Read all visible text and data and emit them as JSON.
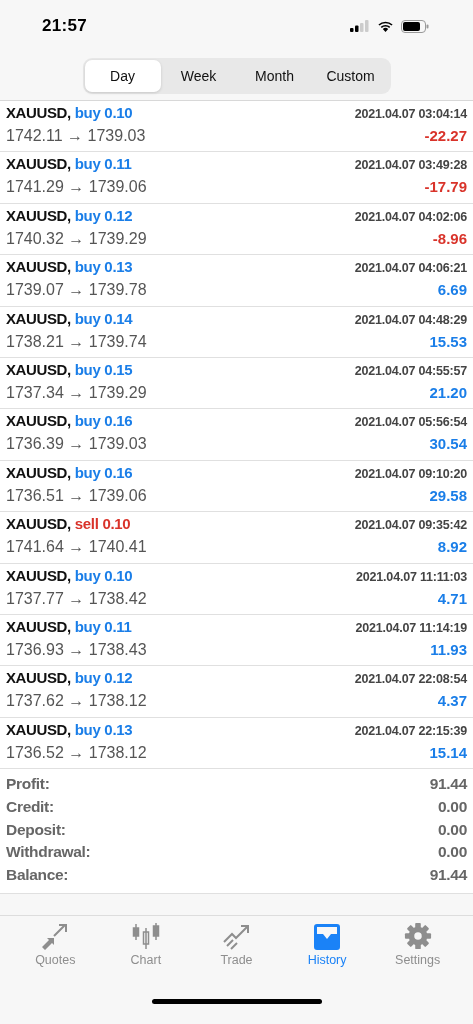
{
  "status_bar": {
    "time": "21:57"
  },
  "period_tabs": [
    {
      "label": "Day",
      "selected": true
    },
    {
      "label": "Week",
      "selected": false
    },
    {
      "label": "Month",
      "selected": false
    },
    {
      "label": "Custom",
      "selected": false
    }
  ],
  "deals": [
    {
      "symbol": "XAUUSD,",
      "kind": "buy",
      "order": "buy 0.10",
      "time": "2021.04.07 03:04:14",
      "prices": "1742.11 → 1739.03",
      "profit": "-22.27",
      "loss": true
    },
    {
      "symbol": "XAUUSD,",
      "kind": "buy",
      "order": "buy 0.11",
      "time": "2021.04.07 03:49:28",
      "prices": "1741.29 → 1739.06",
      "profit": "-17.79",
      "loss": true
    },
    {
      "symbol": "XAUUSD,",
      "kind": "buy",
      "order": "buy 0.12",
      "time": "2021.04.07 04:02:06",
      "prices": "1740.32 → 1739.29",
      "profit": "-8.96",
      "loss": true
    },
    {
      "symbol": "XAUUSD,",
      "kind": "buy",
      "order": "buy 0.13",
      "time": "2021.04.07 04:06:21",
      "prices": "1739.07 → 1739.78",
      "profit": "6.69",
      "loss": false
    },
    {
      "symbol": "XAUUSD,",
      "kind": "buy",
      "order": "buy 0.14",
      "time": "2021.04.07 04:48:29",
      "prices": "1738.21 → 1739.74",
      "profit": "15.53",
      "loss": false
    },
    {
      "symbol": "XAUUSD,",
      "kind": "buy",
      "order": "buy 0.15",
      "time": "2021.04.07 04:55:57",
      "prices": "1737.34 → 1739.29",
      "profit": "21.20",
      "loss": false
    },
    {
      "symbol": "XAUUSD,",
      "kind": "buy",
      "order": "buy 0.16",
      "time": "2021.04.07 05:56:54",
      "prices": "1736.39 → 1739.03",
      "profit": "30.54",
      "loss": false
    },
    {
      "symbol": "XAUUSD,",
      "kind": "buy",
      "order": "buy 0.16",
      "time": "2021.04.07 09:10:20",
      "prices": "1736.51 → 1739.06",
      "profit": "29.58",
      "loss": false
    },
    {
      "symbol": "XAUUSD,",
      "kind": "sell",
      "order": "sell 0.10",
      "time": "2021.04.07 09:35:42",
      "prices": "1741.64 → 1740.41",
      "profit": "8.92",
      "loss": false
    },
    {
      "symbol": "XAUUSD,",
      "kind": "buy",
      "order": "buy 0.10",
      "time": "2021.04.07 11:11:03",
      "prices": "1737.77 → 1738.42",
      "profit": "4.71",
      "loss": false
    },
    {
      "symbol": "XAUUSD,",
      "kind": "buy",
      "order": "buy 0.11",
      "time": "2021.04.07 11:14:19",
      "prices": "1736.93 → 1738.43",
      "profit": "11.93",
      "loss": false
    },
    {
      "symbol": "XAUUSD,",
      "kind": "buy",
      "order": "buy 0.12",
      "time": "2021.04.07 22:08:54",
      "prices": "1737.62 → 1738.12",
      "profit": "4.37",
      "loss": false
    },
    {
      "symbol": "XAUUSD,",
      "kind": "buy",
      "order": "buy 0.13",
      "time": "2021.04.07 22:15:39",
      "prices": "1736.52 → 1738.12",
      "profit": "15.14",
      "loss": false
    }
  ],
  "summary": [
    {
      "label": "Profit:",
      "value": "91.44"
    },
    {
      "label": "Credit:",
      "value": "0.00"
    },
    {
      "label": "Deposit:",
      "value": "0.00"
    },
    {
      "label": "Withdrawal:",
      "value": "0.00"
    },
    {
      "label": "Balance:",
      "value": "91.44"
    }
  ],
  "tab_bar": [
    {
      "kind": "quotes",
      "label": "Quotes",
      "selected": false
    },
    {
      "kind": "chart",
      "label": "Chart",
      "selected": false
    },
    {
      "kind": "trade",
      "label": "Trade",
      "selected": false
    },
    {
      "kind": "history",
      "label": "History",
      "selected": true
    },
    {
      "kind": "settings",
      "label": "Settings",
      "selected": false
    }
  ]
}
